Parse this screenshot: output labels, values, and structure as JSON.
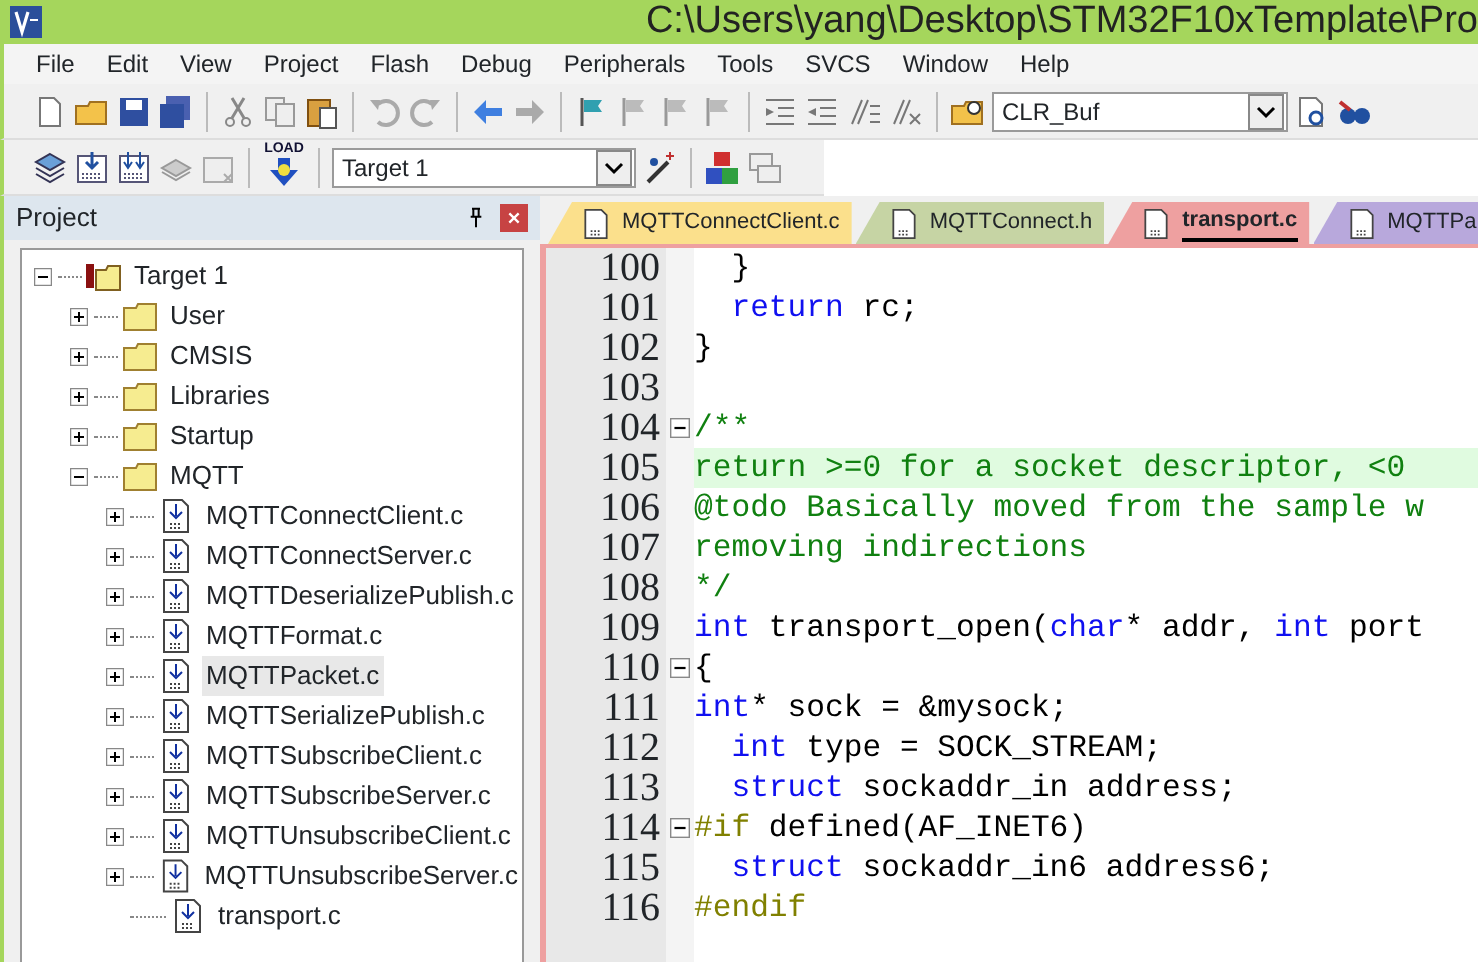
{
  "window": {
    "title": "C:\\Users\\yang\\Desktop\\STM32F10xTemplate\\Pro"
  },
  "menu": [
    "File",
    "Edit",
    "View",
    "Project",
    "Flash",
    "Debug",
    "Peripherals",
    "Tools",
    "SVCS",
    "Window",
    "Help"
  ],
  "toolbar": {
    "find_combo": "CLR_Buf"
  },
  "build_toolbar": {
    "load_label": "LOAD",
    "target_combo": "Target 1"
  },
  "project_panel": {
    "title": "Project",
    "tree": [
      {
        "label": "Target 1",
        "kind": "target",
        "expanded": true,
        "selected": false,
        "children": [
          {
            "label": "User",
            "kind": "folder",
            "expanded": false,
            "selected": false
          },
          {
            "label": "CMSIS",
            "kind": "folder",
            "expanded": false,
            "selected": false
          },
          {
            "label": "Libraries",
            "kind": "folder",
            "expanded": false,
            "selected": false
          },
          {
            "label": "Startup",
            "kind": "folder",
            "expanded": false,
            "selected": false
          },
          {
            "label": "MQTT",
            "kind": "folder",
            "expanded": true,
            "selected": false,
            "children": [
              {
                "label": "MQTTConnectClient.c",
                "kind": "file",
                "expanded": false,
                "selected": false
              },
              {
                "label": "MQTTConnectServer.c",
                "kind": "file",
                "expanded": false,
                "selected": false
              },
              {
                "label": "MQTTDeserializePublish.c",
                "kind": "file",
                "expanded": false,
                "selected": false
              },
              {
                "label": "MQTTFormat.c",
                "kind": "file",
                "expanded": false,
                "selected": false
              },
              {
                "label": "MQTTPacket.c",
                "kind": "file",
                "expanded": false,
                "selected": true
              },
              {
                "label": "MQTTSerializePublish.c",
                "kind": "file",
                "expanded": false,
                "selected": false
              },
              {
                "label": "MQTTSubscribeClient.c",
                "kind": "file",
                "expanded": false,
                "selected": false
              },
              {
                "label": "MQTTSubscribeServer.c",
                "kind": "file",
                "expanded": false,
                "selected": false
              },
              {
                "label": "MQTTUnsubscribeClient.c",
                "kind": "file",
                "expanded": false,
                "selected": false
              },
              {
                "label": "MQTTUnsubscribeServer.c",
                "kind": "file",
                "expanded": false,
                "selected": false
              },
              {
                "label": "transport.c",
                "kind": "file",
                "selected": false
              }
            ]
          }
        ]
      }
    ]
  },
  "tabs": [
    {
      "label": "MQTTConnectClient.c",
      "color": "#fbe08c",
      "selected": false
    },
    {
      "label": "MQTTConnect.h",
      "color": "#c6d4a4",
      "selected": false
    },
    {
      "label": "transport.c",
      "color": "#eea0a0",
      "selected": true
    },
    {
      "label": "MQTTPa",
      "color": "#b8a8dc",
      "selected": false
    }
  ],
  "editor": {
    "lines": [
      {
        "number": "100",
        "segments": [
          {
            "kind": "plain",
            "text": "  }"
          }
        ]
      },
      {
        "number": "101",
        "segments": [
          {
            "kind": "keyword",
            "text": "  return"
          },
          {
            "kind": "plain",
            "text": " rc;"
          }
        ]
      },
      {
        "number": "102",
        "segments": [
          {
            "kind": "plain",
            "text": "}"
          }
        ]
      },
      {
        "number": "103"
      },
      {
        "number": "104",
        "fold": true,
        "segments": [
          {
            "kind": "comment",
            "text": "/**"
          }
        ]
      },
      {
        "number": "105",
        "current": true,
        "segments": [
          {
            "kind": "comment",
            "text": "return >=0 for a socket descriptor, <0"
          }
        ]
      },
      {
        "number": "106",
        "segments": [
          {
            "kind": "comment",
            "text": "@todo Basically moved from the sample w"
          }
        ]
      },
      {
        "number": "107",
        "segments": [
          {
            "kind": "comment",
            "text": "removing indirections"
          }
        ]
      },
      {
        "number": "108",
        "segments": [
          {
            "kind": "comment",
            "text": "*/"
          }
        ]
      },
      {
        "number": "109",
        "segments": [
          {
            "kind": "keyword",
            "text": "int"
          },
          {
            "kind": "plain",
            "text": " transport_open("
          },
          {
            "kind": "keyword",
            "text": "char"
          },
          {
            "kind": "plain",
            "text": "* addr, "
          },
          {
            "kind": "keyword",
            "text": "int"
          },
          {
            "kind": "plain",
            "text": " port"
          }
        ]
      },
      {
        "number": "110",
        "fold": true,
        "segments": [
          {
            "kind": "plain",
            "text": "{"
          }
        ]
      },
      {
        "number": "111",
        "segments": [
          {
            "kind": "keyword",
            "text": "int"
          },
          {
            "kind": "plain",
            "text": "* sock = &mysock;"
          }
        ]
      },
      {
        "number": "112",
        "segments": [
          {
            "kind": "keyword",
            "text": "  int"
          },
          {
            "kind": "plain",
            "text": " type = SOCK_STREAM;"
          }
        ]
      },
      {
        "number": "113",
        "segments": [
          {
            "kind": "keyword",
            "text": "  struct"
          },
          {
            "kind": "plain",
            "text": " sockaddr_in address;"
          }
        ]
      },
      {
        "number": "114",
        "fold": true,
        "segments": [
          {
            "kind": "preproc",
            "text": "#if"
          },
          {
            "kind": "plain",
            "text": " defined(AF_INET6)"
          }
        ]
      },
      {
        "number": "115",
        "segments": [
          {
            "kind": "keyword",
            "text": "  struct"
          },
          {
            "kind": "plain",
            "text": " sockaddr_in6 address6;"
          }
        ]
      },
      {
        "number": "116",
        "segments": [
          {
            "kind": "preproc",
            "text": "#endif"
          }
        ]
      }
    ]
  }
}
